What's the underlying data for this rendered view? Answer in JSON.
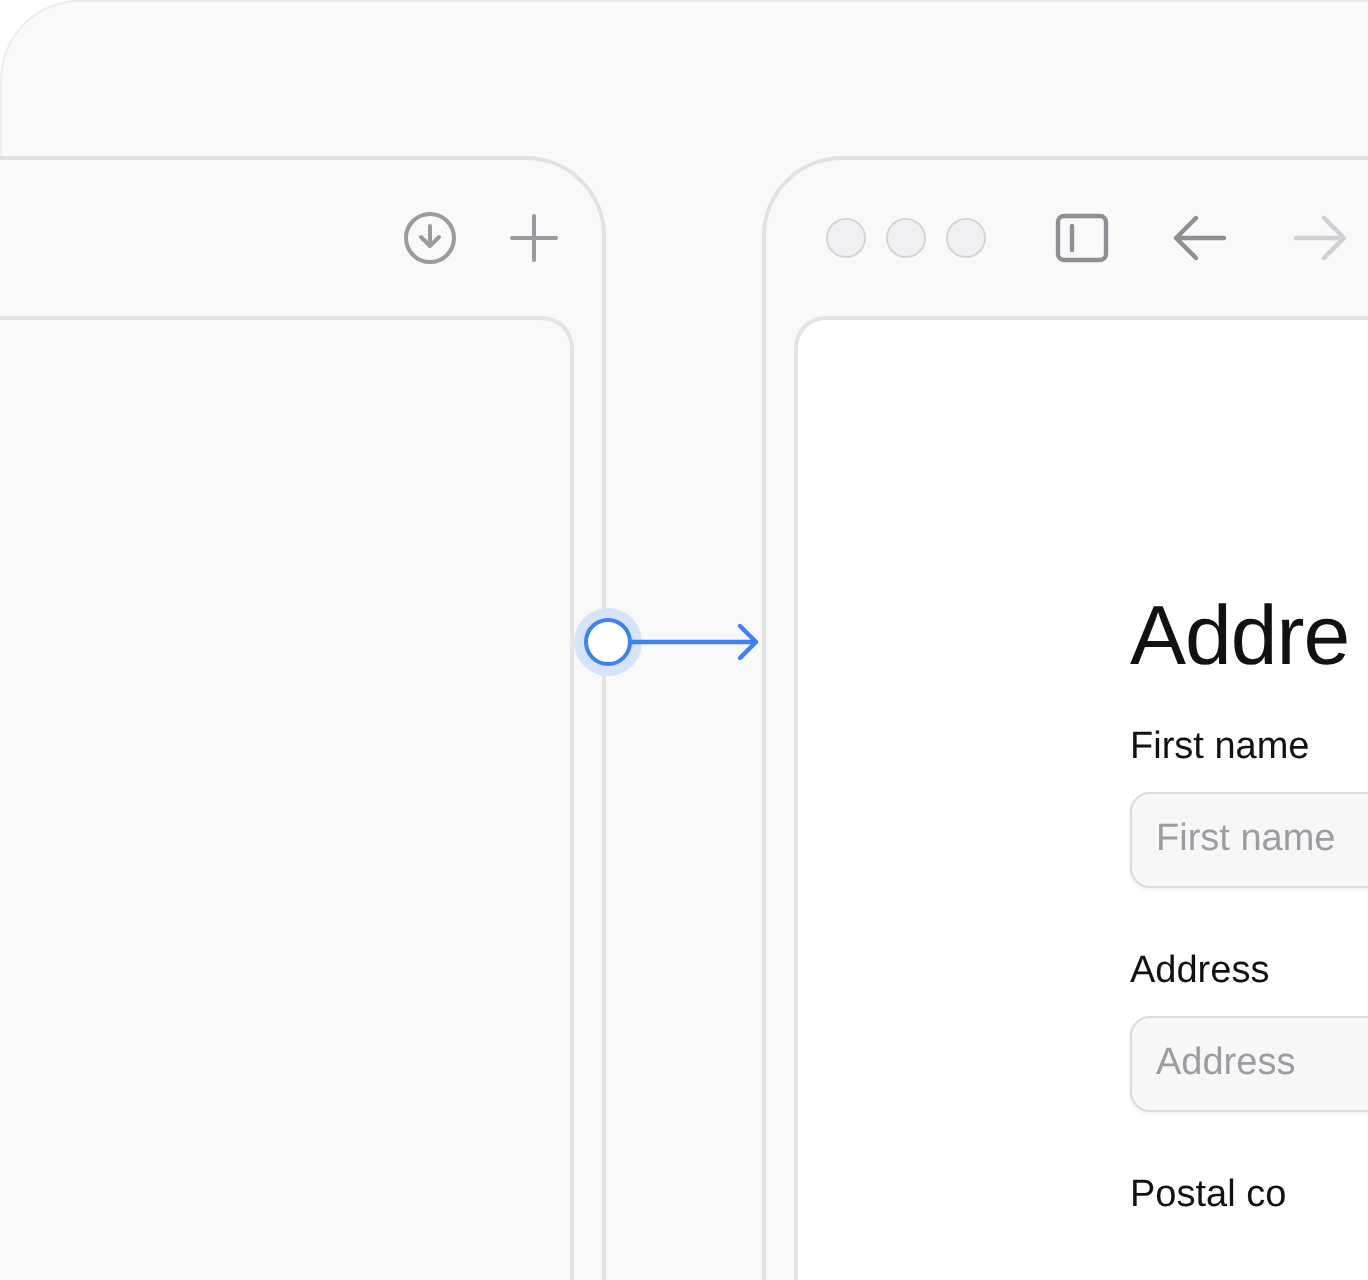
{
  "right_window": {
    "nav_buttons": [
      {
        "kind": "back",
        "disabled": false
      },
      {
        "kind": "forward",
        "disabled": true
      }
    ]
  },
  "form": {
    "heading": "Addre",
    "fields": [
      {
        "label": "First name",
        "placeholder": "First name"
      },
      {
        "label": "Address",
        "placeholder": "Address"
      }
    ],
    "next_label": "Postal co"
  }
}
